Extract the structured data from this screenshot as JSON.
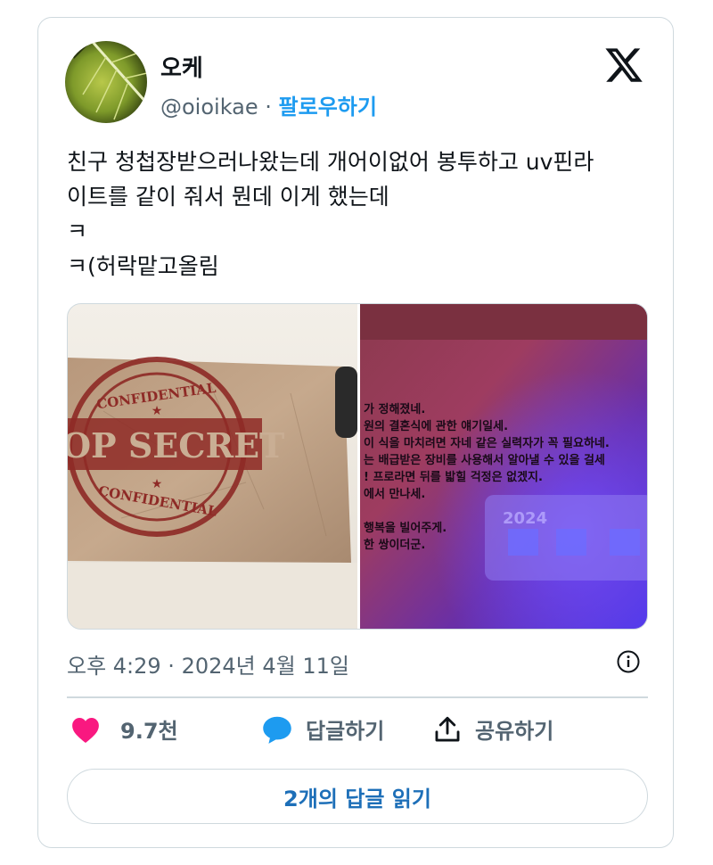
{
  "user": {
    "display_name": "오케",
    "handle": "@oioikae",
    "separator": " · ",
    "follow_label": "팔로우하기"
  },
  "tweet": {
    "text": "친구 청첩장받으러나왔는데 개어이없어 봉투하고 uv핀라\n이트를 같이 줘서 뭔데 이게 했는데\nㅋ\nㅋ(허락맡고올림",
    "timestamp": "오후 4:29 · 2024년 4월 11일"
  },
  "media": {
    "left_image": {
      "stamp_top": "CONFIDENTIAL",
      "stamp_main": "TOP SECRET",
      "stamp_bottom": "CONFIDENTIAL"
    },
    "right_image": {
      "lines": [
        "가 정해졌네.",
        "원의 결혼식에 관한 얘기일세.",
        "이 식을 마치려면 자네 같은 실력자가 꼭 필요하네.",
        "는 배급받은 장비를 사용해서 알아낼 수 있을 걸세",
        "! 프로라면 뒤를 밟힐 걱정은 없겠지.",
        "에서 만나세.",
        "",
        "행복을 빌어주게.",
        "한 쌍이더군."
      ],
      "card_text": "2024"
    }
  },
  "actions": {
    "likes": "9.7천",
    "reply": "답글하기",
    "share": "공유하기"
  },
  "read_replies": "2개의 답글 읽기",
  "colors": {
    "accent": "#1d9bf0",
    "heart": "#f91880",
    "border": "#cfd9de",
    "muted": "#536471"
  }
}
